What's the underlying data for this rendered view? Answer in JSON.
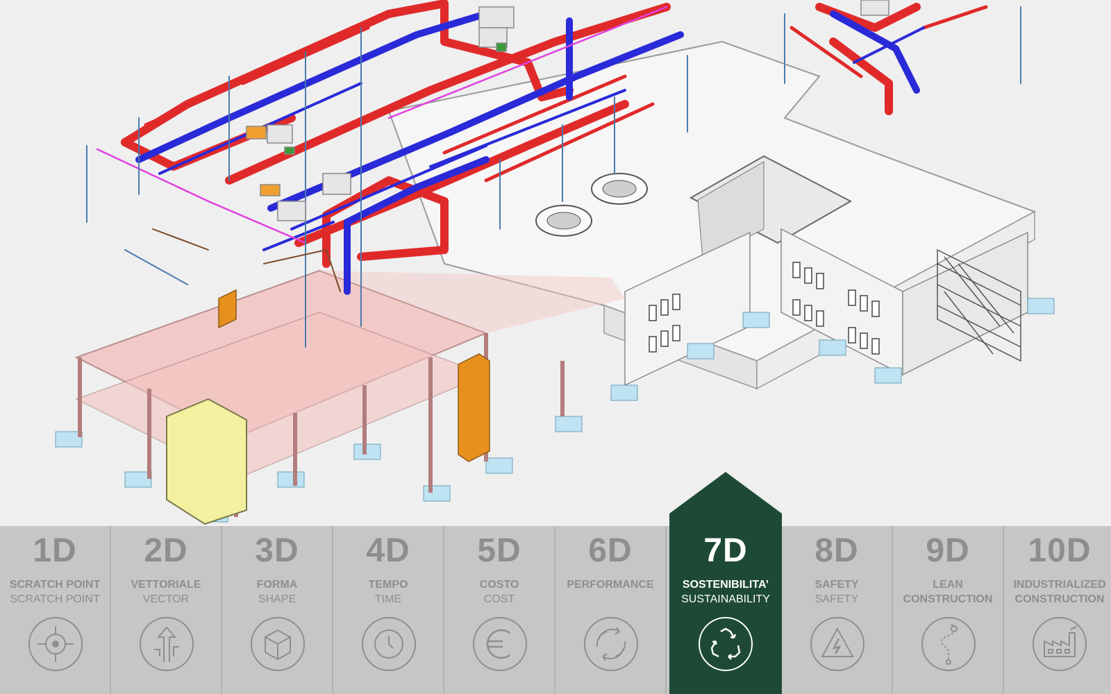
{
  "colors": {
    "panel": "#c6c6c6",
    "tile_text": "#8e8e8e",
    "active_bg": "#1e4a35",
    "active_text": "#ffffff",
    "supply_pipe": "#e02a2a",
    "return_pipe": "#2a2ad8",
    "slab": "#f2c5c2",
    "footing": "#bfe3f2",
    "shaft": "#f3f0a0",
    "opening_frame": "#e8901e"
  },
  "dimensions": [
    {
      "code": "1D",
      "label_it": "SCRATCH POINT",
      "label_en": "SCRATCH POINT",
      "icon": "target-icon",
      "active": false
    },
    {
      "code": "2D",
      "label_it": "VETTORIALE",
      "label_en": "VECTOR",
      "icon": "direction-arrows-icon",
      "active": false
    },
    {
      "code": "3D",
      "label_it": "FORMA",
      "label_en": "SHAPE",
      "icon": "cube-icon",
      "active": false
    },
    {
      "code": "4D",
      "label_it": "TEMPO",
      "label_en": "TIME",
      "icon": "clock-icon",
      "active": false
    },
    {
      "code": "5D",
      "label_it": "COSTO",
      "label_en": "COST",
      "icon": "euro-icon",
      "active": false
    },
    {
      "code": "6D",
      "label_it": "PERFORMANCE",
      "label_en": "",
      "icon": "cycle-arrows-icon",
      "active": false
    },
    {
      "code": "7D",
      "label_it": "SOSTENIBILITA’",
      "label_en": "SUSTAINABILITY",
      "icon": "recycle-icon",
      "active": true
    },
    {
      "code": "8D",
      "label_it": "SAFETY",
      "label_en": "SAFETY",
      "icon": "high-voltage-icon",
      "active": false
    },
    {
      "code": "9D",
      "label_it": "LEAN",
      "label_en": "CONSTRUCTION",
      "icon": "route-icon",
      "active": false
    },
    {
      "code": "10D",
      "label_it": "INDUSTRIALIZED",
      "label_en": "CONSTRUCTION",
      "icon": "factory-icon",
      "active": false
    }
  ]
}
